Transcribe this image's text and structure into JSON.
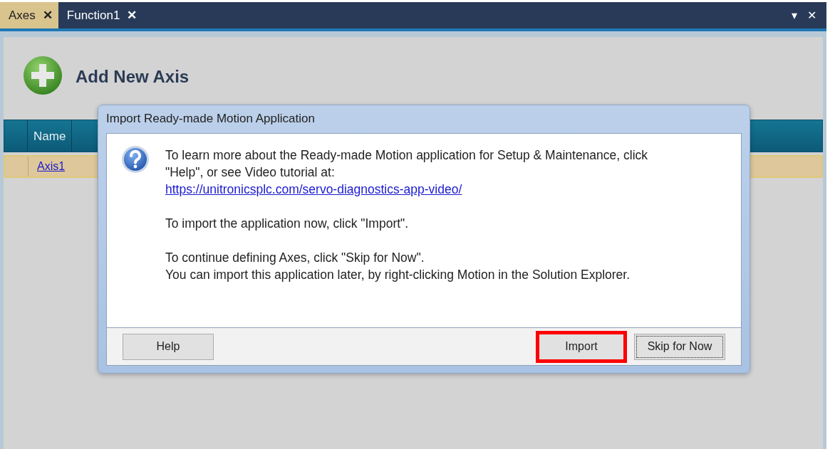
{
  "tabs": [
    {
      "label": "Axes",
      "close": "✕",
      "selected": true
    },
    {
      "label": "Function1",
      "close": "✕",
      "selected": false
    }
  ],
  "tab_bar_controls": {
    "menu": "▾",
    "close": "✕"
  },
  "page": {
    "add_button": "Add New Axis",
    "table": {
      "columns": [
        "Name"
      ],
      "rows": [
        {
          "cells": [
            "Axis1"
          ],
          "selected": true
        }
      ]
    }
  },
  "dialog": {
    "title": "Import Ready-made Motion Application",
    "paragraphs": [
      {
        "lines": [
          "To learn more about the Ready-made Motion application for Setup & Maintenance, click",
          "\"Help\", or see Video tutorial at:"
        ],
        "link": "https://unitronicsplc.com/servo-diagnostics-app-video/"
      },
      {
        "lines": [
          "To import the application now, click \"Import\"."
        ]
      },
      {
        "lines": [
          "To continue defining Axes, click \"Skip for Now\".",
          "You can import this application later, by right-clicking Motion in the Solution Explorer."
        ]
      }
    ],
    "buttons": [
      {
        "label": "Help",
        "highlighted": false,
        "focused": false
      },
      {
        "label": "Import",
        "highlighted": true,
        "focused": false
      },
      {
        "label": "Skip for Now",
        "highlighted": false,
        "focused": true
      }
    ]
  }
}
